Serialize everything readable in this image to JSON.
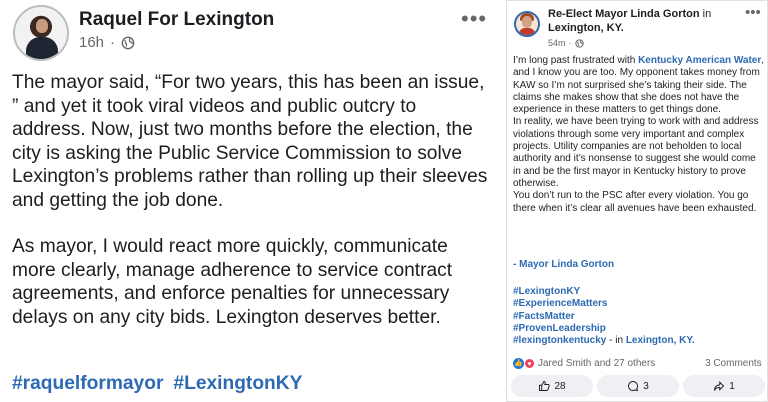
{
  "left_post": {
    "author": "Raquel For Lexington",
    "time": "16h",
    "dot": "·",
    "privacy_icon": "globe-icon",
    "more_icon": "more-horizontal-icon",
    "paragraphs": [
      "The mayor said, “For two years, this has been an issue, ” and yet it took viral videos and public outcry to address. Now, just two months before the election, the city is asking the Public Service Commission to solve Lexington’s problems rather than rolling up their sleeves and getting the job done.",
      "As mayor, I would react more quickly, communicate more clearly, manage adherence to service contract agreements, and enforce penalties for unnecessary delays on any city bids. Lexington deserves better."
    ],
    "hashtags": [
      "#raquelformayor",
      "#LexingtonKY"
    ]
  },
  "right_post": {
    "author": "Re-Elect Mayor Linda Gorton",
    "in_word": "in",
    "location": "Lexington, KY.",
    "time": "54m",
    "dot": "·",
    "lines": {
      "p1_a": "I’m long past frustrated with ",
      "p1_link": "Kentucky American Water",
      "p1_b": ", and I know you are too. My opponent takes money from KAW so I’m not surprised she’s taking their side. The claims she makes show that she does not have the experience in these matters to get things done.",
      "p2": "In reality, we have been trying to work with and address violations through some very important and complex projects. Utility companies are not beholden to local authority and it’s nonsense to suggest she would come in and be the first mayor in Kentucky history to prove otherwise.",
      "p3": "You don’t run to the PSC after every violation. You go there when it’s clear all avenues have been exhausted."
    },
    "signature": "- Mayor Linda Gorton",
    "hashtags": [
      "#LexingtonKY",
      "#ExperienceMatters",
      "#FactsMatter",
      "#ProvenLeadership",
      "#lexingtonkentucky"
    ],
    "tag_suffix": " - in ",
    "tag_location": "Lexington, KY.",
    "reactions_text": "Jared Smith and 27 others",
    "comments_text": "3 Comments",
    "buttons": {
      "like_count": "28",
      "comment_count": "3",
      "share_count": "1"
    }
  },
  "colors": {
    "link": "#2d6ab3",
    "muted": "#65676b",
    "button_bg": "#eef0f3"
  }
}
